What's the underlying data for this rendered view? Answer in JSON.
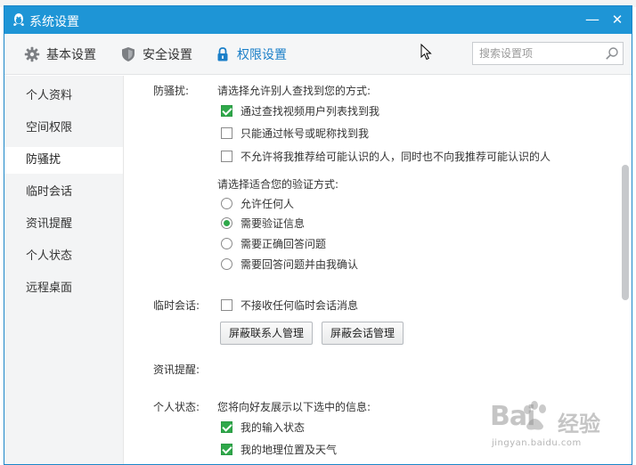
{
  "window": {
    "title": "系统设置",
    "minimize_glyph": "—",
    "close_glyph": "✕"
  },
  "toolbar": {
    "tabs": [
      {
        "label": "基本设置",
        "icon": "gear-icon"
      },
      {
        "label": "安全设置",
        "icon": "shield-icon"
      },
      {
        "label": "权限设置",
        "icon": "lock-icon",
        "active": true
      }
    ],
    "search_placeholder": "搜索设置项"
  },
  "sidebar": {
    "items": [
      {
        "label": "个人资料"
      },
      {
        "label": "空间权限"
      },
      {
        "label": "防骚扰",
        "active": true
      },
      {
        "label": "临时会话"
      },
      {
        "label": "资讯提醒"
      },
      {
        "label": "个人状态"
      },
      {
        "label": "远程桌面"
      }
    ]
  },
  "anti_harassment": {
    "label": "防骚扰:",
    "find_prompt": "请选择允许别人查找到您的方式:",
    "find_options": [
      {
        "label": "通过查找视频用户列表找到我",
        "checked": true
      },
      {
        "label": "只能通过帐号或昵称找到我",
        "checked": false
      },
      {
        "label": "不允许将我推荐给可能认识的人，同时也不向我推荐可能认识的人",
        "checked": false
      }
    ],
    "verify_prompt": "请选择适合您的验证方式:",
    "verify_options": [
      {
        "label": "允许任何人",
        "selected": false
      },
      {
        "label": "需要验证信息",
        "selected": true
      },
      {
        "label": "需要正确回答问题",
        "selected": false
      },
      {
        "label": "需要回答问题并由我确认",
        "selected": false
      }
    ]
  },
  "temp_session": {
    "label": "临时会话:",
    "option": {
      "label": "不接收任何临时会话消息",
      "checked": false
    },
    "buttons": {
      "block_contacts": "屏蔽联系人管理",
      "block_sessions": "屏蔽会话管理"
    }
  },
  "news_reminder": {
    "label": "资讯提醒:"
  },
  "personal_status": {
    "label": "个人状态:",
    "prompt": "您将向好友展示以下选中的信息:",
    "options": [
      {
        "label": "我的输入状态",
        "checked": true
      },
      {
        "label": "我的地理位置及天气",
        "checked": true
      }
    ]
  },
  "watermark": {
    "logo": "Bai",
    "brand": "经验",
    "url": "jingyan.baidu.com"
  },
  "colors": {
    "titlebar": "#1e95d6",
    "accent": "#1a7fc8",
    "check": "#2fa84a"
  }
}
